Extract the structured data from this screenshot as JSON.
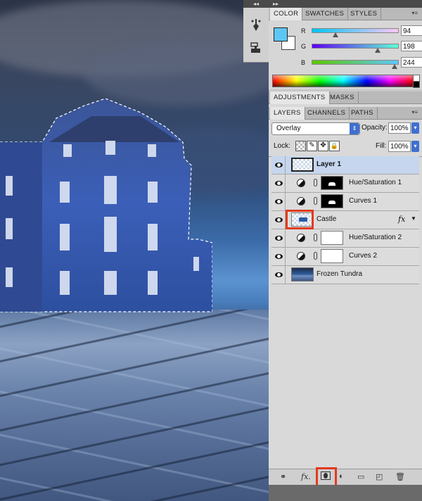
{
  "tools": {
    "collapse_glyph": "◂◂",
    "icons": [
      "brush-preset-icon",
      "clone-source-icon"
    ]
  },
  "color_panel": {
    "collapse_glyph": "▸▸",
    "tabs": [
      "COLOR",
      "SWATCHES",
      "STYLES"
    ],
    "active_tab": "COLOR",
    "foreground": "#5ec6f4",
    "background": "#ffffff",
    "channels": [
      {
        "label": "R",
        "value": "94"
      },
      {
        "label": "G",
        "value": "198"
      },
      {
        "label": "B",
        "value": "244"
      }
    ]
  },
  "adjustments_panel": {
    "tabs": [
      "ADJUSTMENTS",
      "MASKS"
    ]
  },
  "layers_panel": {
    "tabs": [
      "LAYERS",
      "CHANNELS",
      "PATHS"
    ],
    "blend_mode": "Overlay",
    "opacity_label": "Opacity:",
    "opacity_value": "100%",
    "lock_label": "Lock:",
    "fill_label": "Fill:",
    "fill_value": "100%",
    "fx_label": "fx",
    "layers": [
      {
        "name": "Layer 1",
        "type": "pixel",
        "selected": true
      },
      {
        "name": "Hue/Saturation 1",
        "type": "adjustment",
        "mask": "black-with-shape"
      },
      {
        "name": "Curves 1",
        "type": "adjustment",
        "mask": "black-with-shape"
      },
      {
        "name": "Castle",
        "type": "pixel",
        "has_fx": true,
        "highlighted": true
      },
      {
        "name": "Hue/Saturation 2",
        "type": "adjustment",
        "mask": "white"
      },
      {
        "name": "Curves 2",
        "type": "adjustment",
        "mask": "white"
      },
      {
        "name": "Frozen Tundra",
        "type": "pixel"
      }
    ],
    "bottom_icons": [
      "link-layers-icon",
      "fx-icon",
      "add-mask-icon",
      "adjustment-layer-icon",
      "group-folder-icon",
      "new-layer-icon",
      "trash-icon"
    ],
    "bottom_fx_label": "fx."
  },
  "colors": {
    "highlight": "#e23a1c",
    "selected_row": "#c5d6ee"
  }
}
